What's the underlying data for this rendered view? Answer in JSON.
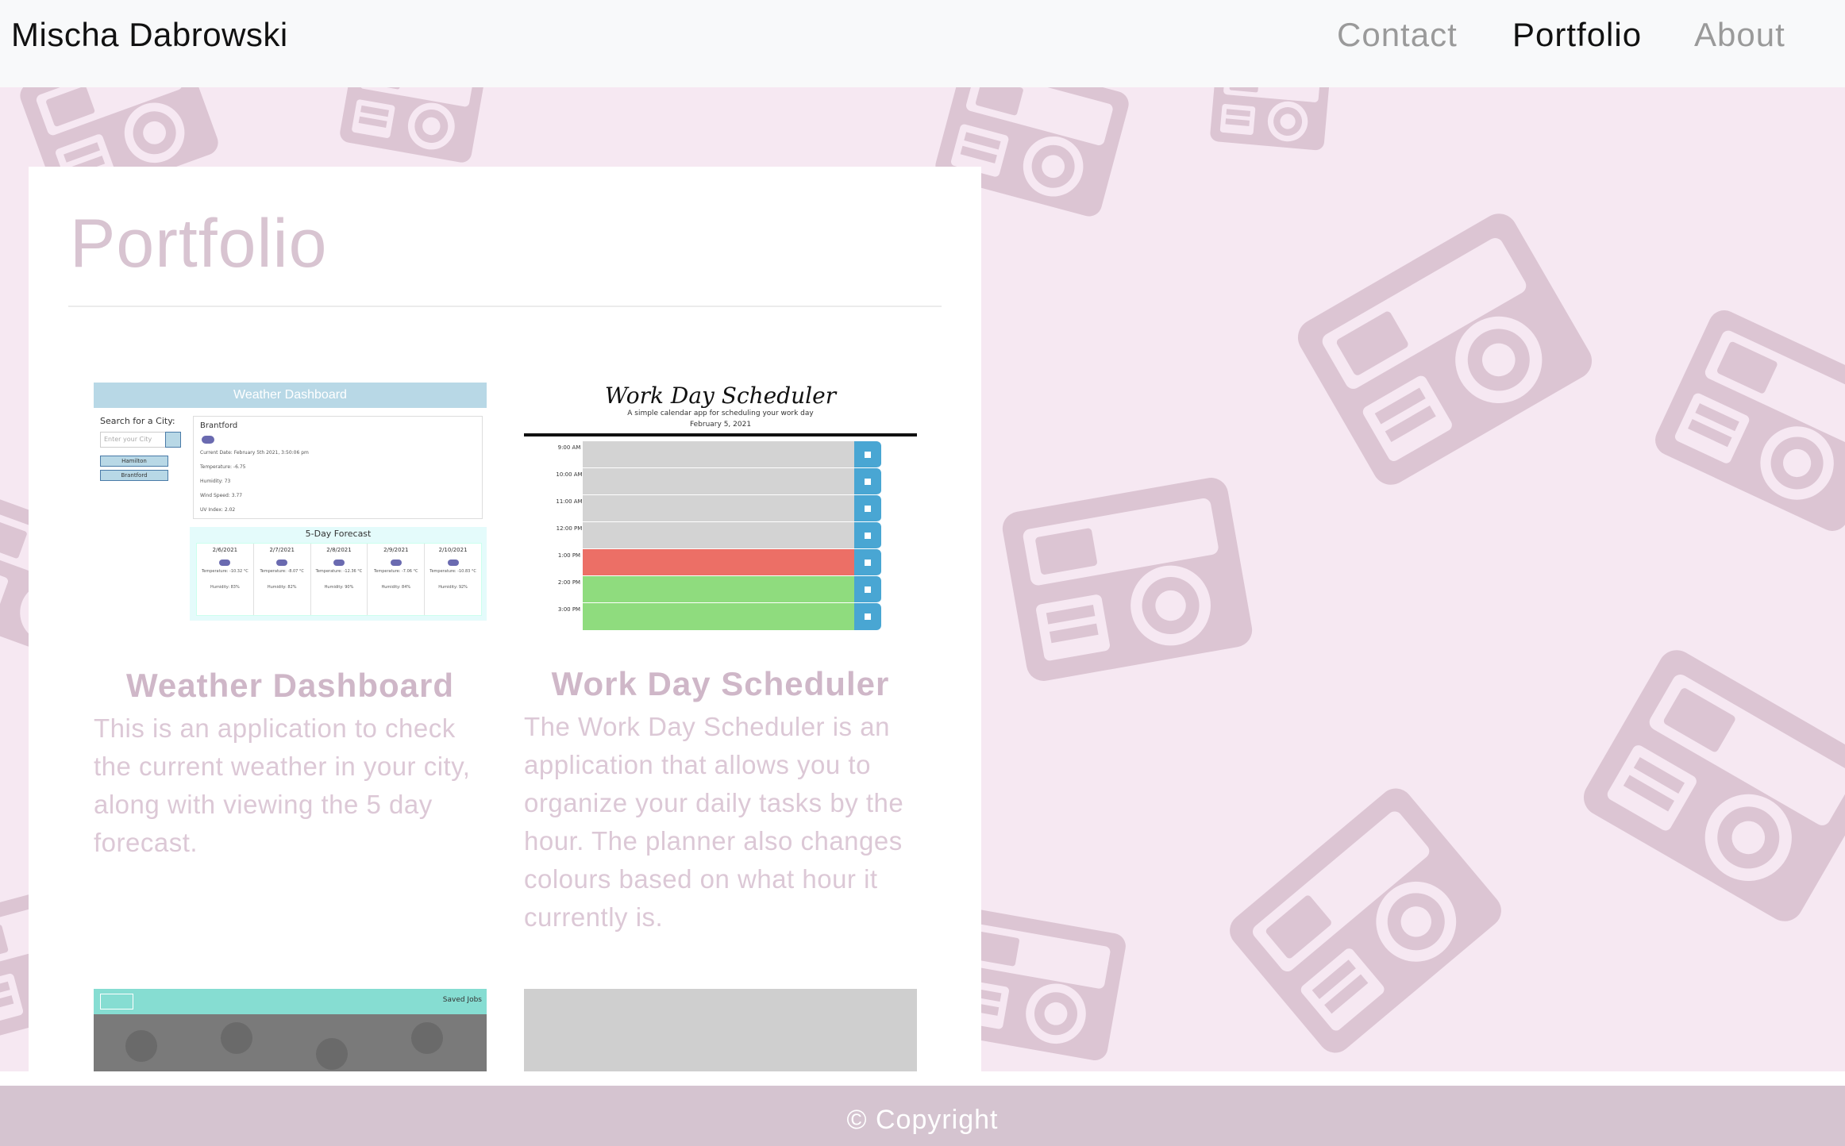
{
  "navbar": {
    "brand": "Mischa Dabrowski",
    "links": [
      {
        "label": "Contact",
        "active": false
      },
      {
        "label": "Portfolio",
        "active": true
      },
      {
        "label": "About",
        "active": false
      }
    ]
  },
  "main": {
    "title": "Portfolio",
    "projects": [
      {
        "title": "Weather Dashboard",
        "description": "This is an application to check the current weather in your city, along with viewing the 5 day forecast.",
        "thumbnail": {
          "header": "Weather Dashboard",
          "search_label": "Search for a City:",
          "search_placeholder": "Enter your City",
          "history": [
            "Hamilton",
            "Brantford"
          ],
          "city": "Brantford",
          "current_date": "Current Date: February 5th 2021, 3:50:06 pm",
          "temperature": "Temperature: -6.75",
          "humidity": "Humidity: 73",
          "wind": "Wind Speed: 3.77",
          "uv": "UV Index: 2.02",
          "forecast_title": "5-Day Forecast",
          "forecast": [
            {
              "date": "2/6/2021",
              "temp": "Temperature: -10.32 °C",
              "humidity": "Humidity: 83%"
            },
            {
              "date": "2/7/2021",
              "temp": "Temperature: -8.07 °C",
              "humidity": "Humidity: 82%"
            },
            {
              "date": "2/8/2021",
              "temp": "Temperature: -12.36 °C",
              "humidity": "Humidity: 90%"
            },
            {
              "date": "2/9/2021",
              "temp": "Temperature: -7.06 °C",
              "humidity": "Humidity: 84%"
            },
            {
              "date": "2/10/2021",
              "temp": "Temperature: -10.83 °C",
              "humidity": "Humidity: 92%"
            }
          ]
        }
      },
      {
        "title": "Work Day Scheduler",
        "description": "The Work Day Scheduler is an application that allows you to organize your daily tasks by the hour. The planner also changes colours based on what hour it currently is.",
        "thumbnail": {
          "header": "Work Day Scheduler",
          "subtitle": "A simple calendar app for scheduling your work day",
          "date": "February 5, 2021",
          "hours": [
            "9:00 AM",
            "10:00 AM",
            "11:00 AM",
            "12:00 PM",
            "1:00 PM",
            "2:00 PM",
            "3:00 PM"
          ],
          "save_icon": "save-icon"
        }
      },
      {
        "title": "",
        "description": "",
        "thumbnail": {
          "header_right": "Saved Jobs"
        }
      },
      {
        "title": "",
        "description": "",
        "thumbnail": {}
      }
    ]
  },
  "footer": {
    "text": "© Copyright"
  },
  "colors": {
    "navbar_bg": "#f8f9fa",
    "pattern_bg": "#f6e8f2",
    "pattern_ink": "#dcc5d3",
    "accent": "#d5c4d0",
    "past_hour": "#d3d3d3",
    "present_hour": "#ec6f66",
    "future_hour": "#8fdc7e",
    "save_button": "#49a6d3"
  }
}
